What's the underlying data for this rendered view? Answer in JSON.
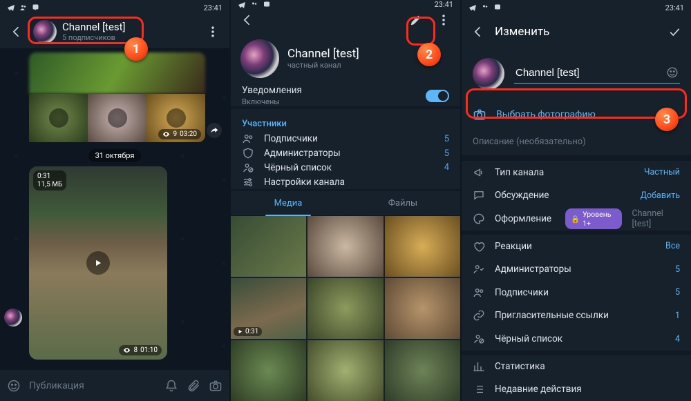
{
  "status": {
    "time": "23:41"
  },
  "callouts": {
    "n1": "1",
    "n2": "2",
    "n3": "3"
  },
  "panel1": {
    "title": "Channel [test]",
    "subtitle": "5 подписчиков",
    "album_meta": {
      "views": "9",
      "dur": "03:20"
    },
    "date": "31 октября",
    "video": {
      "dur": "0:31",
      "size": "11,5 МБ",
      "views": "8",
      "time": "01:10"
    },
    "compose_placeholder": "Публикация"
  },
  "panel2": {
    "title": "Channel [test]",
    "subtitle": "частный канал",
    "notify_label": "Уведомления",
    "notify_state": "Включены",
    "section_members": "Участники",
    "rows": {
      "subs": {
        "label": "Подписчики",
        "count": "5"
      },
      "admins": {
        "label": "Администраторы",
        "count": "5"
      },
      "black": {
        "label": "Чёрный список",
        "count": "4"
      },
      "sett": {
        "label": "Настройки канала"
      }
    },
    "tabs": {
      "media": "Медиа",
      "files": "Файлы"
    },
    "media_dur": "0:31"
  },
  "panel3": {
    "header": "Изменить",
    "name_value": "Channel [test]",
    "choose_photo": "Выбрать фотографию",
    "desc_placeholder": "Описание (необязательно)",
    "rows": {
      "type": {
        "label": "Тип канала",
        "value": "Частный"
      },
      "discuss": {
        "label": "Обсуждение",
        "value": "Добавить"
      },
      "theme": {
        "label": "Оформление",
        "badge": "Уровень 1+",
        "value": "Channel [test]"
      },
      "react": {
        "label": "Реакции",
        "value": "Все"
      },
      "admins": {
        "label": "Администраторы",
        "value": "5"
      },
      "subs": {
        "label": "Подписчики",
        "value": "5"
      },
      "invite": {
        "label": "Пригласительные ссылки",
        "value": "1"
      },
      "black": {
        "label": "Чёрный список",
        "value": "4"
      },
      "stats": {
        "label": "Статистика"
      },
      "recent": {
        "label": "Недавние действия"
      }
    }
  }
}
